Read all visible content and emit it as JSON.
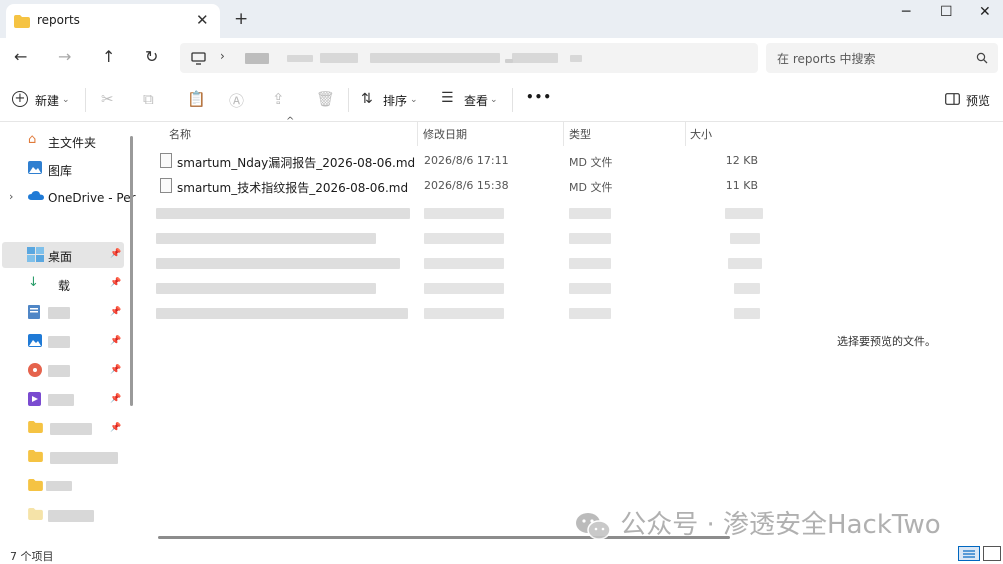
{
  "window": {
    "tab_title": "reports",
    "new_tab_label": "+",
    "tab_close_label": "✕",
    "minimize_label": "─",
    "maximize_label": "☐",
    "close_label": "✕"
  },
  "address": {
    "search_placeholder": "在 reports 中搜索"
  },
  "toolbar": {
    "new_label": "新建",
    "sort_label": "排序",
    "view_label": "查看",
    "more_label": "•••",
    "preview_label": "预览"
  },
  "sidebar": {
    "items": [
      {
        "label": "主文件夹",
        "icon": "home-icon"
      },
      {
        "label": "图库",
        "icon": "gallery-icon"
      },
      {
        "label": "OneDrive - Per",
        "icon": "cloud-icon"
      },
      {
        "label": "桌面",
        "icon": "desktop-icon"
      },
      {
        "label": "载",
        "icon": "download-icon"
      }
    ]
  },
  "columns": {
    "name": "名称",
    "date": "修改日期",
    "type": "类型",
    "size": "大小"
  },
  "files": [
    {
      "name": "smartum_Nday漏洞报告_2026-08-06.md",
      "date": "2026/8/6 17:11",
      "type": "MD 文件",
      "size": "12 KB"
    },
    {
      "name": "smartum_技术指纹报告_2026-08-06.md",
      "date": "2026/8/6 15:38",
      "type": "MD 文件",
      "size": "11 KB"
    }
  ],
  "preview": {
    "empty_message": "选择要预览的文件。"
  },
  "status": {
    "item_count": "7 个项目"
  },
  "watermark": {
    "text": "公众号 · 渗透安全HackTwo"
  },
  "colors": {
    "accent": "#0067c0",
    "folder": "#f5c343",
    "selection": "#e5e5e5"
  }
}
